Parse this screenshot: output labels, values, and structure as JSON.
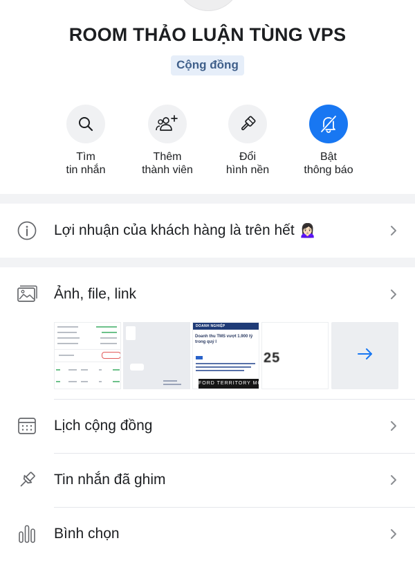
{
  "group": {
    "title": "ROOM THẢO LUẬN TÙNG VPS",
    "badge": "Cộng đồng"
  },
  "actions": [
    {
      "icon": "search-icon",
      "line1": "Tìm",
      "line2": "tin nhắn"
    },
    {
      "icon": "add-people-icon",
      "line1": "Thêm",
      "line2": "thành viên"
    },
    {
      "icon": "paintbrush-icon",
      "line1": "Đổi",
      "line2": "hình nền"
    },
    {
      "icon": "bell-off-icon",
      "line1": "Bật",
      "line2": "thông báo"
    }
  ],
  "rows": {
    "description": {
      "icon": "info-icon",
      "label": "Lợi nhuận của khách hàng là trên hết 🙍🏻‍♀️"
    },
    "media": {
      "icon": "gallery-icon",
      "label": "Ảnh, file, link"
    },
    "calendar": {
      "icon": "calendar-icon",
      "label": "Lịch cộng đồng"
    },
    "pinned": {
      "icon": "pin-icon",
      "label": "Tin nhắn đã ghim"
    },
    "poll": {
      "icon": "poll-icon",
      "label": "Bình chọn"
    }
  },
  "media_thumbs": {
    "thumb3_header": "DOANH NGHIỆP",
    "thumb3_title": "Doanh thu TMS vượt 1.900 tỷ trong quý I",
    "thumb3_footer": "FORD TERRITORY MỚI",
    "thumb4_number": "25",
    "more_icon": "arrow-right-icon"
  },
  "colors": {
    "accent": "#1877f2",
    "badge_bg": "#e6eef9",
    "badge_text": "#3f5f8a",
    "divider": "#f2f3f5"
  }
}
